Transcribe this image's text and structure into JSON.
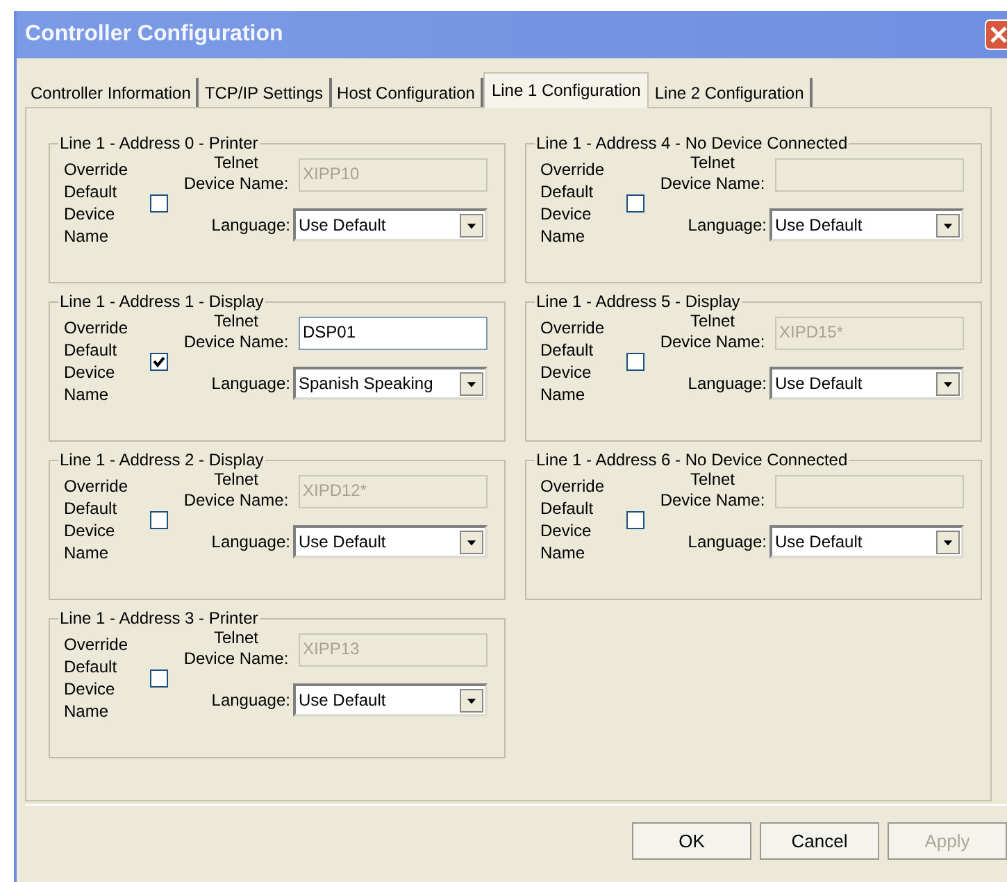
{
  "window": {
    "title": "Controller Configuration"
  },
  "tabs": [
    {
      "label": "Controller Information",
      "selected": false
    },
    {
      "label": "TCP/IP Settings",
      "selected": false
    },
    {
      "label": "Host Configuration",
      "selected": false
    },
    {
      "label": "Line 1 Configuration",
      "selected": true
    },
    {
      "label": "Line 2 Configuration",
      "selected": false
    }
  ],
  "columns": [
    {
      "groups": [
        {
          "title": "Line 1 - Address 0 - Printer",
          "override_label": "Override Default Device Name",
          "checked": false,
          "name_label_top": "Telnet",
          "name_label": "Device Name:",
          "name_value": "XIPP10",
          "name_disabled": true,
          "language_label": "Language:",
          "language": "Use Default"
        },
        {
          "title": "Line 1 - Address 1 - Display",
          "override_label": "Override Default Device Name",
          "checked": true,
          "name_label_top": "Telnet",
          "name_label": "Device Name:",
          "name_value": "DSP01",
          "name_disabled": false,
          "language_label": "Language:",
          "language": "Spanish Speaking"
        },
        {
          "title": "Line 1 - Address 2 - Display",
          "override_label": "Override Default Device Name",
          "checked": false,
          "name_label_top": "Telnet",
          "name_label": "Device Name:",
          "name_value": "XIPD12*",
          "name_disabled": true,
          "language_label": "Language:",
          "language": "Use Default"
        },
        {
          "title": "Line 1 - Address 3 - Printer",
          "override_label": "Override Default Device Name",
          "checked": false,
          "name_label_top": "Telnet",
          "name_label": "Device Name:",
          "name_value": "XIPP13",
          "name_disabled": true,
          "language_label": "Language:",
          "language": "Use Default"
        }
      ]
    },
    {
      "groups": [
        {
          "title": "Line 1 - Address 4 - No Device Connected",
          "override_label": "Override Default Device Name",
          "checked": false,
          "name_label_top": "Telnet",
          "name_label": "Device Name:",
          "name_disabled": true,
          "language_label": "Language:",
          "language": "Use Default"
        },
        {
          "title": "Line 1 - Address 5 - Display",
          "override_label": "Override Default Device Name",
          "checked": false,
          "name_label_top": "Telnet",
          "name_label": "Device Name:",
          "name_value": "XIPD15*",
          "name_disabled": true,
          "language_label": "Language:",
          "language": "Use Default"
        },
        {
          "title": "Line 1 - Address 6 - No Device Connected",
          "override_label": "Override Default Device Name",
          "checked": false,
          "name_label_top": "Telnet",
          "name_label": "Device Name:",
          "name_disabled": true,
          "language_label": "Language:",
          "language": "Use Default"
        }
      ]
    }
  ],
  "buttons": [
    {
      "label": "OK",
      "disabled": false
    },
    {
      "label": "Cancel",
      "disabled": false
    },
    {
      "label": "Apply",
      "disabled": true
    }
  ]
}
